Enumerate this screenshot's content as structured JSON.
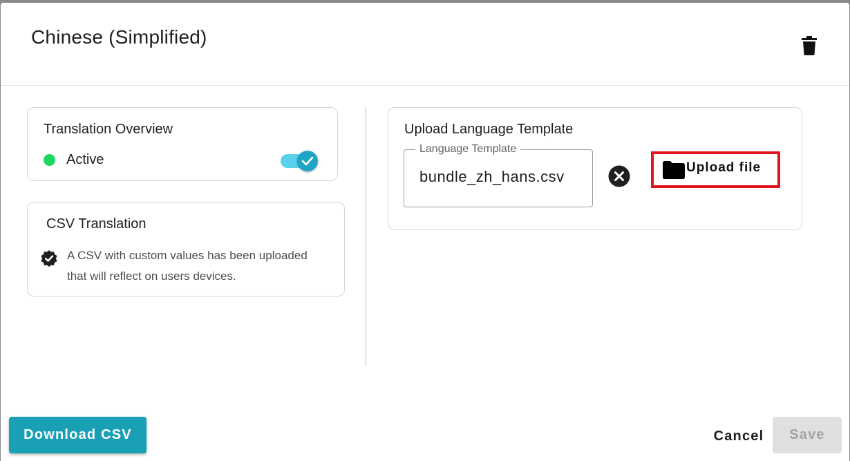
{
  "dialog": {
    "title": "Chinese (Simplified)"
  },
  "overview": {
    "title": "Translation Overview",
    "status_label": "Active",
    "status_color": "#1ed760",
    "toggle_on": true
  },
  "csv": {
    "title": "CSV Translation",
    "description": "A CSV with custom values has been uploaded that will reflect on users devices."
  },
  "upload": {
    "title": "Upload Language Template",
    "field_label": "Language Template",
    "field_value": "bundle_zh_hans.csv",
    "upload_label": "Upload file"
  },
  "footer": {
    "download_label": "Download CSV",
    "cancel_label": "Cancel",
    "save_label": "Save"
  },
  "colors": {
    "accent": "#1aa0b5",
    "highlight": "#e0161c"
  }
}
